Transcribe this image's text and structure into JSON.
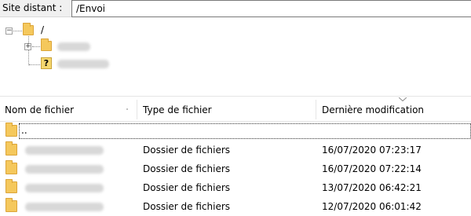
{
  "pathbar": {
    "label": "Site distant :",
    "value": "/Envoi"
  },
  "tree": {
    "root": {
      "label": "/",
      "expander": "−"
    },
    "children": [
      {
        "expander": "+",
        "icon": "folder",
        "label_redacted": true
      },
      {
        "expander": "",
        "icon": "unknown-folder",
        "icon_glyph": "?",
        "label_redacted": true
      }
    ]
  },
  "columns": {
    "name": "Nom de fichier",
    "type": "Type de fichier",
    "modified": "Dernière modification"
  },
  "files": {
    "parent": {
      "name": ".."
    },
    "rows": [
      {
        "type": "Dossier de fichiers",
        "modified": "16/07/2020 07:23:17"
      },
      {
        "type": "Dossier de fichiers",
        "modified": "16/07/2020 07:22:14"
      },
      {
        "type": "Dossier de fichiers",
        "modified": "13/07/2020 06:42:21"
      },
      {
        "type": "Dossier de fichiers",
        "modified": "12/07/2020 06:01:42"
      }
    ]
  },
  "colors": {
    "folder": "#f5c85c",
    "folder_border": "#dba53a",
    "toolbar_bg": "#f0f0f0"
  }
}
